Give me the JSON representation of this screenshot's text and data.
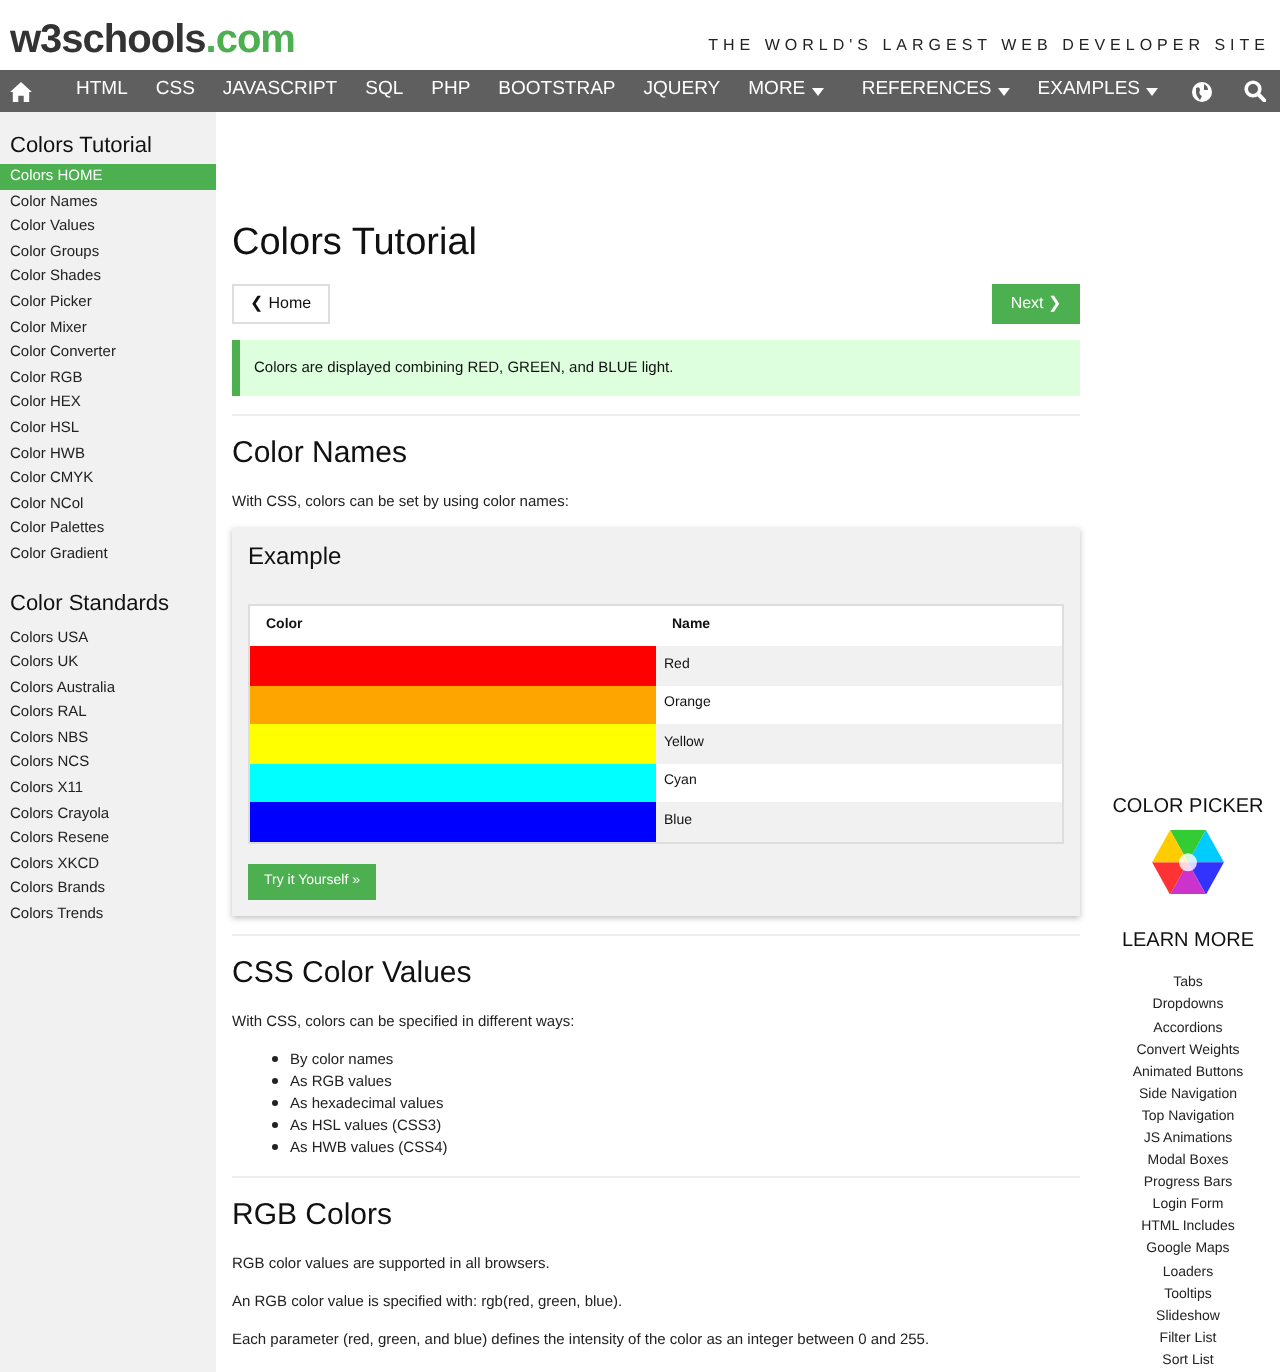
{
  "header": {
    "logo_name": "w3schools",
    "logo_domain": ".com",
    "tagline": "THE WORLD'S LARGEST WEB DEVELOPER SITE"
  },
  "nav": {
    "left_links": [
      {
        "label": "HTML",
        "dropdown": false
      },
      {
        "label": "CSS",
        "dropdown": false
      },
      {
        "label": "JAVASCRIPT",
        "dropdown": false
      },
      {
        "label": "SQL",
        "dropdown": false
      },
      {
        "label": "PHP",
        "dropdown": false
      },
      {
        "label": "BOOTSTRAP",
        "dropdown": false
      },
      {
        "label": "JQUERY",
        "dropdown": false
      },
      {
        "label": "MORE",
        "dropdown": true
      }
    ],
    "right_links": [
      {
        "label": "REFERENCES",
        "dropdown": true
      },
      {
        "label": "EXAMPLES",
        "dropdown": true
      }
    ]
  },
  "sidebar": {
    "sections": [
      {
        "heading": "Colors Tutorial",
        "items": [
          {
            "label": "Colors HOME",
            "selected": true
          },
          {
            "label": "Color Names",
            "selected": false
          },
          {
            "label": "Color Values",
            "selected": false
          },
          {
            "label": "Color Groups",
            "selected": false
          },
          {
            "label": "Color Shades",
            "selected": false
          },
          {
            "label": "Color Picker",
            "selected": false
          },
          {
            "label": "Color Mixer",
            "selected": false
          },
          {
            "label": "Color Converter",
            "selected": false
          },
          {
            "label": "Color RGB",
            "selected": false
          },
          {
            "label": "Color HEX",
            "selected": false
          },
          {
            "label": "Color HSL",
            "selected": false
          },
          {
            "label": "Color HWB",
            "selected": false
          },
          {
            "label": "Color CMYK",
            "selected": false
          },
          {
            "label": "Color NCol",
            "selected": false
          },
          {
            "label": "Color Palettes",
            "selected": false
          },
          {
            "label": "Color Gradient",
            "selected": false
          }
        ]
      },
      {
        "heading": "Color Standards",
        "items": [
          {
            "label": "Colors USA",
            "selected": false
          },
          {
            "label": "Colors UK",
            "selected": false
          },
          {
            "label": "Colors Australia",
            "selected": false
          },
          {
            "label": "Colors RAL",
            "selected": false
          },
          {
            "label": "Colors NBS",
            "selected": false
          },
          {
            "label": "Colors NCS",
            "selected": false
          },
          {
            "label": "Colors X11",
            "selected": false
          },
          {
            "label": "Colors Crayola",
            "selected": false
          },
          {
            "label": "Colors Resene",
            "selected": false
          },
          {
            "label": "Colors XKCD",
            "selected": false
          },
          {
            "label": "Colors Brands",
            "selected": false
          },
          {
            "label": "Colors Trends",
            "selected": false
          }
        ]
      }
    ]
  },
  "main": {
    "title": "Colors Tutorial",
    "prev_button": "❮ Home",
    "next_button": "Next ❯",
    "note": "Colors are displayed combining RED, GREEN, and BLUE light.",
    "sections": [
      {
        "heading": "Color Names",
        "paragraphs": [
          "With CSS, colors can be set by using color names:"
        ],
        "example": {
          "title": "Example",
          "columns": [
            "Color",
            "Name"
          ],
          "rows": [
            {
              "color": "#ff0000",
              "name": "Red"
            },
            {
              "color": "#ffa500",
              "name": "Orange"
            },
            {
              "color": "#ffff00",
              "name": "Yellow"
            },
            {
              "color": "#00ffff",
              "name": "Cyan"
            },
            {
              "color": "#0000ff",
              "name": "Blue"
            }
          ],
          "button": "Try it Yourself »"
        }
      },
      {
        "heading": "CSS Color Values",
        "paragraphs": [
          "With CSS, colors can be specified in different ways:"
        ],
        "bullets": [
          "By color names",
          "As RGB values",
          "As hexadecimal values",
          "As HSL values (CSS3)",
          "As HWB values (CSS4)"
        ]
      },
      {
        "heading": "RGB Colors",
        "paragraphs": [
          "RGB color values are supported in all browsers.",
          "An RGB color value is specified with: rgb(red, green, blue).",
          "Each parameter (red, green, and blue) defines the intensity of the color as an integer between 0 and 255."
        ]
      }
    ]
  },
  "right": {
    "color_picker_title": "COLOR PICKER",
    "learn_more_title": "LEARN MORE",
    "links": [
      "Tabs",
      "Dropdowns",
      "Accordions",
      "Convert Weights",
      "Animated Buttons",
      "Side Navigation",
      "Top Navigation",
      "JS Animations",
      "Modal Boxes",
      "Progress Bars",
      "Login Form",
      "HTML Includes",
      "Google Maps",
      "Loaders",
      "Tooltips",
      "Slideshow",
      "Filter List",
      "Sort List"
    ]
  }
}
